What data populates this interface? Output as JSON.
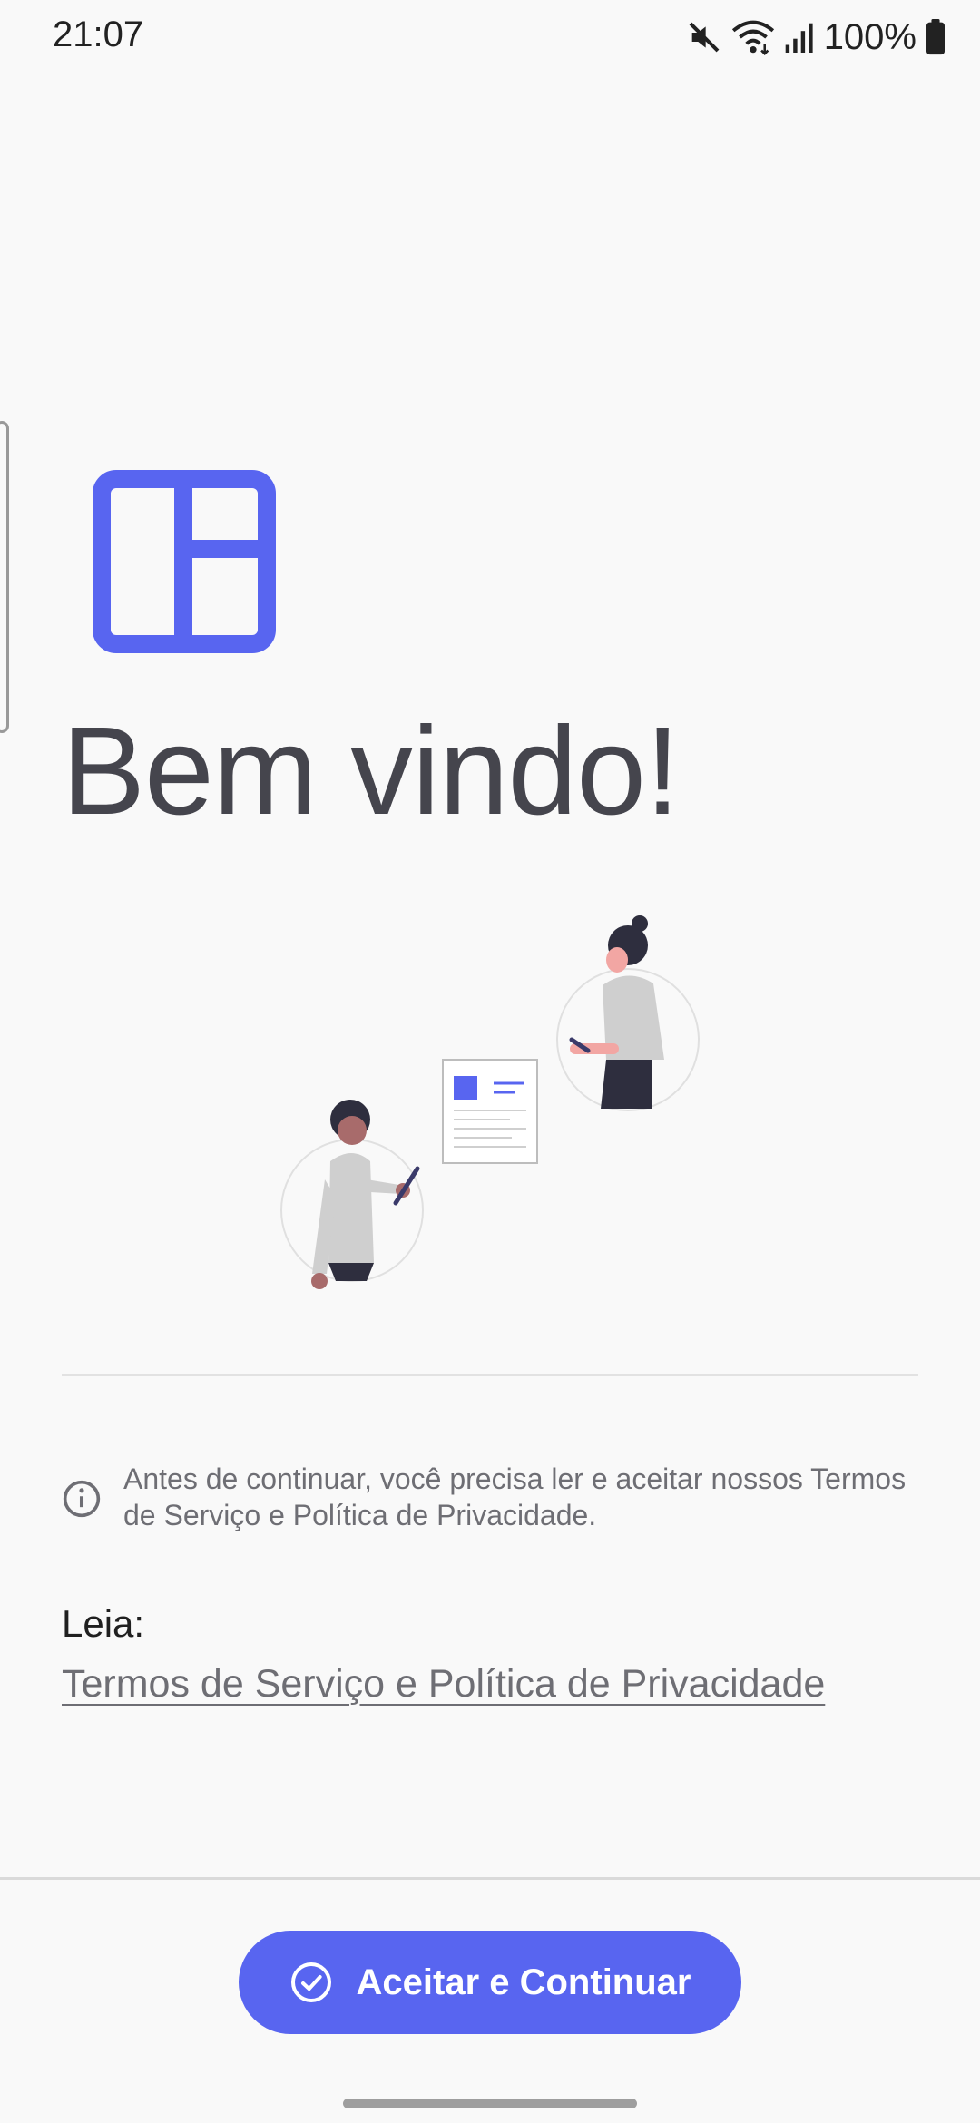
{
  "status_bar": {
    "time": "21:07",
    "battery": "100%",
    "icons": [
      "mute-icon",
      "wifi-icon",
      "signal-icon",
      "battery-icon"
    ]
  },
  "welcome": {
    "title": "Bem vindo!"
  },
  "notice": {
    "text": "Antes de continuar, você precisa ler e aceitar nossos Termos de Serviço e Política de Privacidade."
  },
  "read": {
    "label": "Leia:",
    "link_text": "Termos de Serviço e Política de Privacidade"
  },
  "actions": {
    "accept_label": "Aceitar e Continuar"
  },
  "colors": {
    "accent": "#5865f0",
    "title_text": "#45454d",
    "muted_text": "#6e6e74",
    "background": "#f9f9f9"
  }
}
